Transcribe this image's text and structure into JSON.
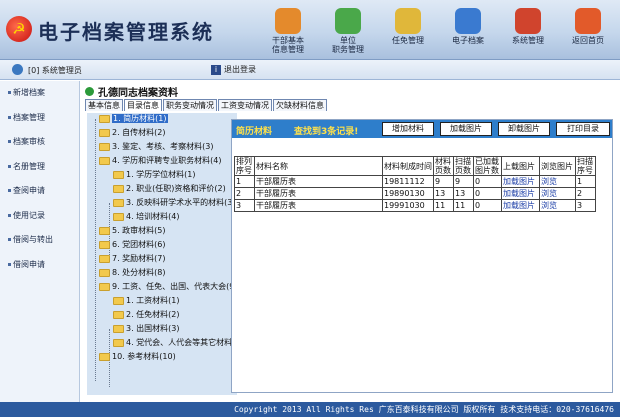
{
  "app": {
    "title": "电子档案管理系统",
    "emblem": "☭"
  },
  "nav": [
    {
      "label": "干部基本\n信息管理",
      "icon": "group-people-icon",
      "color": "#e48a2c"
    },
    {
      "label": "单位\n职务管理",
      "icon": "organization-blocks-icon",
      "color": "#4aa84a"
    },
    {
      "label": "任免管理",
      "icon": "pen-edit-icon",
      "color": "#e0b73a"
    },
    {
      "label": "电子档案",
      "icon": "book-file-icon",
      "color": "#3a7ad0"
    },
    {
      "label": "系统管理",
      "icon": "calculator-settings-icon",
      "color": "#d0442d"
    },
    {
      "label": "返回首页",
      "icon": "home-icon",
      "color": "#e25a2a"
    }
  ],
  "user": {
    "text": "[0] 系统管理员",
    "logout": "退出登录"
  },
  "sidebar": [
    "新增档案",
    "档案管理",
    "档案审核",
    "名册管理",
    "查阅申请",
    "使用记录",
    "借阅与转出",
    "借阅申请"
  ],
  "doc": {
    "title": "孔德同志档案资料"
  },
  "tabs": [
    "基本信息",
    "目录信息",
    "职务变动情况",
    "工资变动情况",
    "欠缺材料信息"
  ],
  "tree": [
    "1. 简历材料(1)",
    "2. 自传材料(2)",
    "3. 鉴定、考核、考察材料(3)",
    "4. 学历和评聘专业职务材料(4)",
    "1. 学历学位材料(1)",
    "2. 职业(任职)资格和评价(2)",
    "3. 反映科研学术水平的材料(3)",
    "4. 培训材料(4)",
    "5. 政审材料(5)",
    "6. 党团材料(6)",
    "7. 奖励材料(7)",
    "8. 处分材料(8)",
    "9. 工资、任免、出国、代表大会(9)",
    "1. 工资材料(1)",
    "2. 任免材料(2)",
    "3. 出国材料(3)",
    "4. 党代会、人代会等其它材料(4)",
    "10. 参考材料(10)"
  ],
  "panel": {
    "section": "简历材料",
    "found": "查找到3条记录!",
    "buttons": [
      "增加材料",
      "加载图片",
      "卸载图片",
      "打印目录"
    ]
  },
  "table": {
    "headers": [
      "排列\n序号",
      "材料名称",
      "材料制成时间",
      "材料\n页数",
      "扫描\n页数",
      "已加载\n图片数",
      "上载图片",
      "浏览图片",
      "扫描\n序号"
    ],
    "rows": [
      [
        "1",
        "干部履历表",
        "19811112",
        "9",
        "9",
        "0",
        "加载图片",
        "浏览",
        "1"
      ],
      [
        "2",
        "干部履历表",
        "19890130",
        "13",
        "13",
        "0",
        "加载图片",
        "浏览",
        "2"
      ],
      [
        "3",
        "干部履历表",
        "19991030",
        "11",
        "11",
        "0",
        "加载图片",
        "浏览",
        "3"
      ]
    ]
  },
  "footer": "Copyright 2013 All Rights Res  广东百泰科技有限公司 版权所有  技术支持电话：020-37616476"
}
